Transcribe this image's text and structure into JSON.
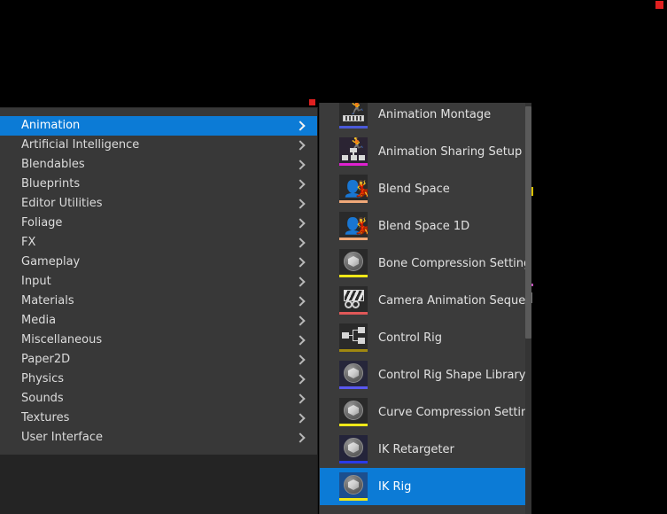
{
  "window": {
    "background_color": "#000000",
    "corner_marker_color": "#e02020"
  },
  "primary_menu": {
    "name": "asset-category-menu",
    "background_color": "#383838",
    "highlight_color": "#0c7bd6",
    "text_color": "#dcdcdc",
    "selected_index": 0,
    "items": [
      {
        "label": "Animation",
        "has_submenu": true,
        "selected": true
      },
      {
        "label": "Artificial Intelligence",
        "has_submenu": true,
        "selected": false
      },
      {
        "label": "Blendables",
        "has_submenu": true,
        "selected": false
      },
      {
        "label": "Blueprints",
        "has_submenu": true,
        "selected": false
      },
      {
        "label": "Editor Utilities",
        "has_submenu": true,
        "selected": false
      },
      {
        "label": "Foliage",
        "has_submenu": true,
        "selected": false
      },
      {
        "label": "FX",
        "has_submenu": true,
        "selected": false
      },
      {
        "label": "Gameplay",
        "has_submenu": true,
        "selected": false
      },
      {
        "label": "Input",
        "has_submenu": true,
        "selected": false
      },
      {
        "label": "Materials",
        "has_submenu": true,
        "selected": false
      },
      {
        "label": "Media",
        "has_submenu": true,
        "selected": false
      },
      {
        "label": "Miscellaneous",
        "has_submenu": true,
        "selected": false
      },
      {
        "label": "Paper2D",
        "has_submenu": true,
        "selected": false
      },
      {
        "label": "Physics",
        "has_submenu": true,
        "selected": false
      },
      {
        "label": "Sounds",
        "has_submenu": true,
        "selected": false
      },
      {
        "label": "Textures",
        "has_submenu": true,
        "selected": false
      },
      {
        "label": "User Interface",
        "has_submenu": true,
        "selected": false
      }
    ]
  },
  "submenu": {
    "name": "animation-asset-submenu",
    "parent_label": "Animation",
    "background_color": "#3b3b3b",
    "highlight_color": "#0c7bd6",
    "selected_item": "IK Rig",
    "scrollbar": {
      "visible": true,
      "thumb_color": "#5a5a5a",
      "track_color": "#343434"
    },
    "items": [
      {
        "label": "Animation Montage",
        "icon": "animation-montage-icon",
        "glyph": "montage",
        "type_color": "#4a5ad8",
        "tile_color": "#2a2a2a",
        "selected": false
      },
      {
        "label": "Animation Sharing Setup",
        "icon": "animation-sharing-setup-icon",
        "glyph": "sharing",
        "type_color": "#e020d0",
        "tile_color": "#2b2433",
        "selected": false
      },
      {
        "label": "Blend Space",
        "icon": "blend-space-icon",
        "glyph": "blendspace",
        "type_color": "#f0a878",
        "tile_color": "#2a2a2a",
        "selected": false
      },
      {
        "label": "Blend Space 1D",
        "icon": "blend-space-1d-icon",
        "glyph": "blendspace",
        "type_color": "#f0a878",
        "tile_color": "#2a2a2a",
        "selected": false
      },
      {
        "label": "Bone Compression Settings",
        "icon": "bone-compression-settings-icon",
        "glyph": "sphere",
        "type_color": "#f0e818",
        "tile_color": "#2a2a2a",
        "selected": false
      },
      {
        "label": "Camera Animation Sequence",
        "icon": "camera-animation-sequence-icon",
        "glyph": "camera",
        "type_color": "#e05858",
        "tile_color": "#2a2a2a",
        "selected": false
      },
      {
        "label": "Control Rig",
        "icon": "control-rig-icon",
        "glyph": "rig",
        "type_color": "#a08810",
        "tile_color": "#2a2a2a",
        "selected": false
      },
      {
        "label": "Control Rig Shape Library",
        "icon": "control-rig-shape-library-icon",
        "glyph": "sphere",
        "type_color": "#5a58f0",
        "tile_color": "#26263a",
        "selected": false
      },
      {
        "label": "Curve Compression Settings",
        "icon": "curve-compression-settings-icon",
        "glyph": "sphere",
        "type_color": "#f0e818",
        "tile_color": "#2a2a2a",
        "selected": false
      },
      {
        "label": "IK Retargeter",
        "icon": "ik-retargeter-icon",
        "glyph": "sphere",
        "type_color": "#2a3ae8",
        "tile_color": "#24243a",
        "selected": false
      },
      {
        "label": "IK Rig",
        "icon": "ik-rig-icon",
        "glyph": "sphere",
        "type_color": "#f0e818",
        "tile_color": "#1c4f8e",
        "selected": true
      }
    ]
  }
}
